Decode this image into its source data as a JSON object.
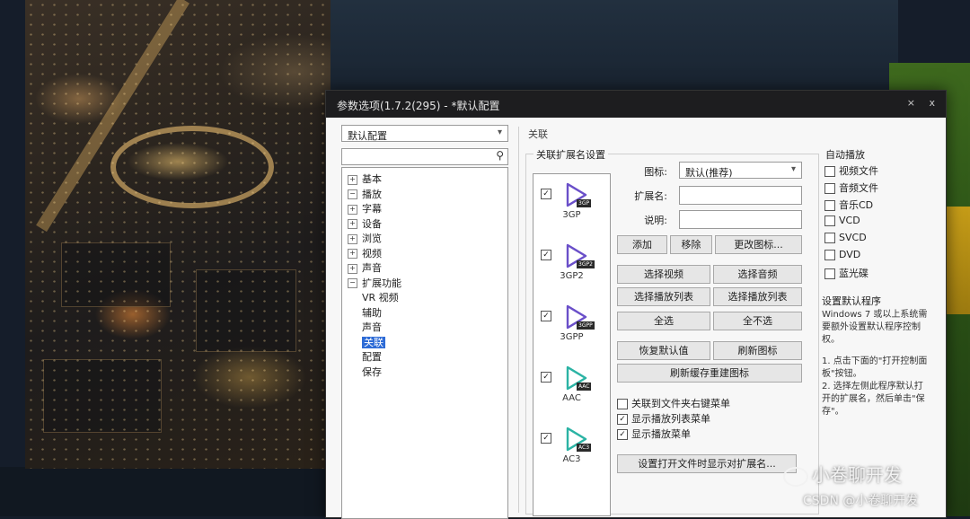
{
  "window": {
    "title": "参数选项(1.7.2(295) - *默认配置",
    "controls": [
      "×",
      "ⅹ"
    ]
  },
  "profile_combo": {
    "value": "默认配置"
  },
  "search": {
    "value": "",
    "icon": "search-icon"
  },
  "tree": {
    "items": [
      {
        "label": "基本",
        "expander": "⊞",
        "level": 0
      },
      {
        "label": "播放",
        "expander": "⊟",
        "level": 0
      },
      {
        "label": "字幕",
        "expander": "⊞",
        "level": 0
      },
      {
        "label": "设备",
        "expander": "⊞",
        "level": 0
      },
      {
        "label": "浏览",
        "expander": "⊞",
        "level": 0
      },
      {
        "label": "视频",
        "expander": "⊞",
        "level": 0
      },
      {
        "label": "声音",
        "expander": "⊞",
        "level": 0
      },
      {
        "label": "扩展功能",
        "expander": "⊟",
        "level": 0
      },
      {
        "label": "VR 视频",
        "expander": "",
        "level": 1
      },
      {
        "label": "辅助",
        "expander": "",
        "level": 1
      },
      {
        "label": "声音",
        "expander": "",
        "level": 1
      },
      {
        "label": "关联",
        "expander": "",
        "level": 1,
        "selected": true
      },
      {
        "label": "配置",
        "expander": "",
        "level": 1
      },
      {
        "label": "保存",
        "expander": "",
        "level": 1
      }
    ]
  },
  "breadcrumb": "关联",
  "assoc_group": {
    "title": "关联扩展名设置",
    "file_types": [
      {
        "name": "3GP",
        "badge": "3GP",
        "checked": true
      },
      {
        "name": "3GP2",
        "badge": "3GP2",
        "checked": true
      },
      {
        "name": "3GPP",
        "badge": "3GPP",
        "checked": true
      },
      {
        "name": "AAC",
        "badge": "AAC",
        "checked": true
      },
      {
        "name": "AC3",
        "badge": "AC3",
        "checked": true
      }
    ],
    "icon_label": "图标:",
    "icon_combo": "默认(推荐)",
    "ext_label": "扩展名:",
    "ext_value": "",
    "desc_label": "说明:",
    "desc_value": "",
    "buttons": {
      "add": "添加",
      "remove": "移除",
      "change_icon": "更改图标...",
      "select_video": "选择视频",
      "select_audio": "选择音频",
      "select_playlist": "选择播放列表",
      "select_playback_list": "选择播放列表",
      "select_all": "全选",
      "select_none": "全不选",
      "restore_defaults": "恢复默认值",
      "refresh_icons": "刷新图标",
      "refresh_shell": "刷新缓存重建图标",
      "bottom": "设置打开文件时显示对扩展名..."
    },
    "checkboxes": [
      {
        "label": "关联到文件夹右键菜单",
        "checked": false
      },
      {
        "label": "显示播放列表菜单",
        "checked": true
      },
      {
        "label": "显示播放菜单",
        "checked": true
      }
    ]
  },
  "autoplay_group": {
    "title": "自动播放",
    "items": [
      {
        "label": "视频文件",
        "checked": false
      },
      {
        "label": "音频文件",
        "checked": false
      },
      {
        "label": "音乐CD",
        "checked": false
      },
      {
        "label": "VCD",
        "checked": false
      },
      {
        "label": "SVCD",
        "checked": false
      },
      {
        "label": "DVD",
        "checked": false
      },
      {
        "label": "蓝光碟",
        "checked": false
      }
    ]
  },
  "default_program": {
    "title": "设置默认程序",
    "text1": "Windows 7 或以上系统需要额外设置默认程序控制权。",
    "text2": "1. 点击下面的\"打开控制面板\"按钮。\n2. 选择左侧此程序默认打开的扩展名，然后单击\"保存\"。"
  },
  "watermark": {
    "line1": "小卷聊开发",
    "line2": "CSDN @小卷聊开发"
  },
  "colors": {
    "selection": "#2d6bd6",
    "play_icon_purple": "#6a4fc9",
    "play_icon_teal": "#2bb3a4"
  }
}
